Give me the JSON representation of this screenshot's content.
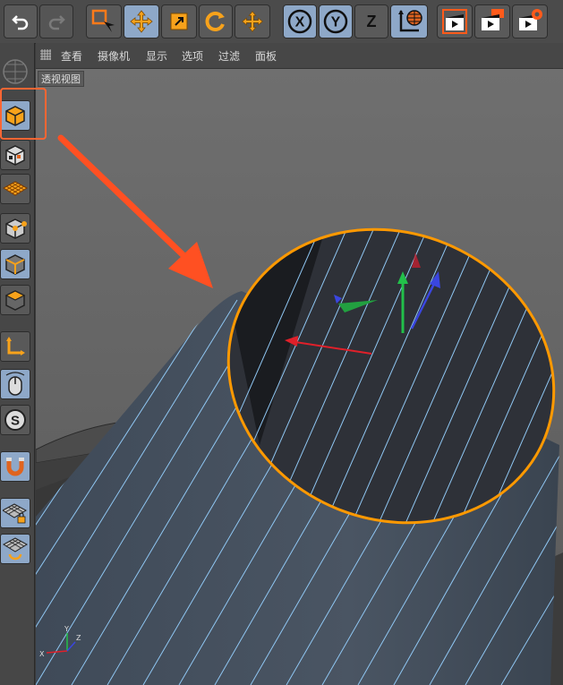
{
  "menubar": {
    "items": [
      "查看",
      "摄像机",
      "显示",
      "选项",
      "过滤",
      "面板"
    ]
  },
  "viewport": {
    "label": "透视视图"
  },
  "axis_gizmo": {
    "x": "X",
    "y": "Y",
    "z": "Z"
  },
  "toolbar": {
    "axis_x": "X",
    "axis_y": "Y",
    "axis_z": "Z",
    "icons": [
      "undo-icon",
      "redo-icon",
      "live-selection-icon",
      "move-icon",
      "scale-icon",
      "rotate-icon",
      "recent-tool-icon",
      "x-axis-lock-icon",
      "y-axis-lock-icon",
      "z-axis-lock-icon",
      "world-coordinate-icon",
      "render-view-icon",
      "render-picture-viewer-icon",
      "render-settings-icon"
    ]
  },
  "leftbar": {
    "icons": [
      "cube-model-icon",
      "texture-mode-icon",
      "workplane-icon",
      "points-mode-icon",
      "edges-mode-icon",
      "polygons-mode-icon",
      "axis-mode-icon",
      "tweak-mode-icon",
      "solo-icon",
      "snapping-icon",
      "lock-workplane-icon",
      "workplane-rotate-icon"
    ]
  },
  "colors": {
    "highlight": "#ff6633",
    "selection_outline": "#ff9900",
    "active_tool_bg": "#8ea8c8",
    "wire_color": "#8fc6f2"
  }
}
